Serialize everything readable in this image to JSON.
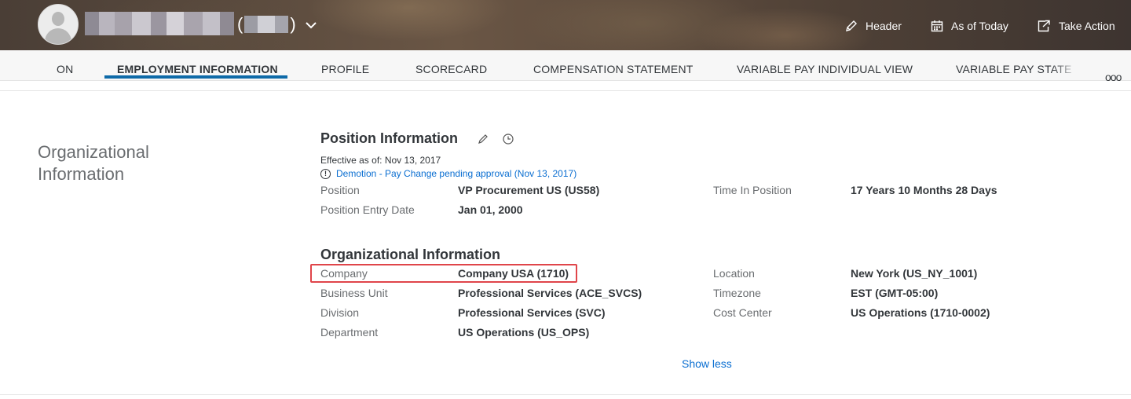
{
  "header": {
    "user_id_open": "(",
    "user_id_close": ")",
    "actions": {
      "header_label": "Header",
      "as_of_label": "As of Today",
      "take_action_label": "Take Action"
    }
  },
  "tabs": [
    {
      "label": "ON"
    },
    {
      "label": "EMPLOYMENT INFORMATION",
      "active": true
    },
    {
      "label": "PROFILE"
    },
    {
      "label": "SCORECARD"
    },
    {
      "label": "COMPENSATION STATEMENT"
    },
    {
      "label": "VARIABLE PAY INDIVIDUAL VIEW"
    },
    {
      "label": "VARIABLE PAY STATE"
    }
  ],
  "more_label": "ooo",
  "section": {
    "title": "Organizational Information"
  },
  "position_info": {
    "title": "Position Information",
    "effective": "Effective as of: Nov 13, 2017",
    "pending": "Demotion - Pay Change pending approval (Nov 13, 2017)",
    "fields": {
      "position_label": "Position",
      "position_value": "VP Procurement US (US58)",
      "entry_label": "Position Entry Date",
      "entry_value": "Jan 01, 2000",
      "time_label": "Time In Position",
      "time_value": "17 Years 10 Months 28 Days"
    }
  },
  "org_info": {
    "title": "Organizational Information",
    "fields": {
      "company_label": "Company",
      "company_value": "Company USA (1710)",
      "bu_label": "Business Unit",
      "bu_value": "Professional Services (ACE_SVCS)",
      "division_label": "Division",
      "division_value": "Professional Services (SVC)",
      "department_label": "Department",
      "department_value": "US Operations (US_OPS)",
      "location_label": "Location",
      "location_value": "New York (US_NY_1001)",
      "timezone_label": "Timezone",
      "timezone_value": "EST (GMT-05:00)",
      "cost_center_label": "Cost Center",
      "cost_center_value": "US Operations (1710-0002)"
    }
  },
  "show_less": "Show less",
  "colors": {
    "accent": "#0a6ed1",
    "tab_underline": "#0e6aa8",
    "highlight": "#e0454a"
  }
}
